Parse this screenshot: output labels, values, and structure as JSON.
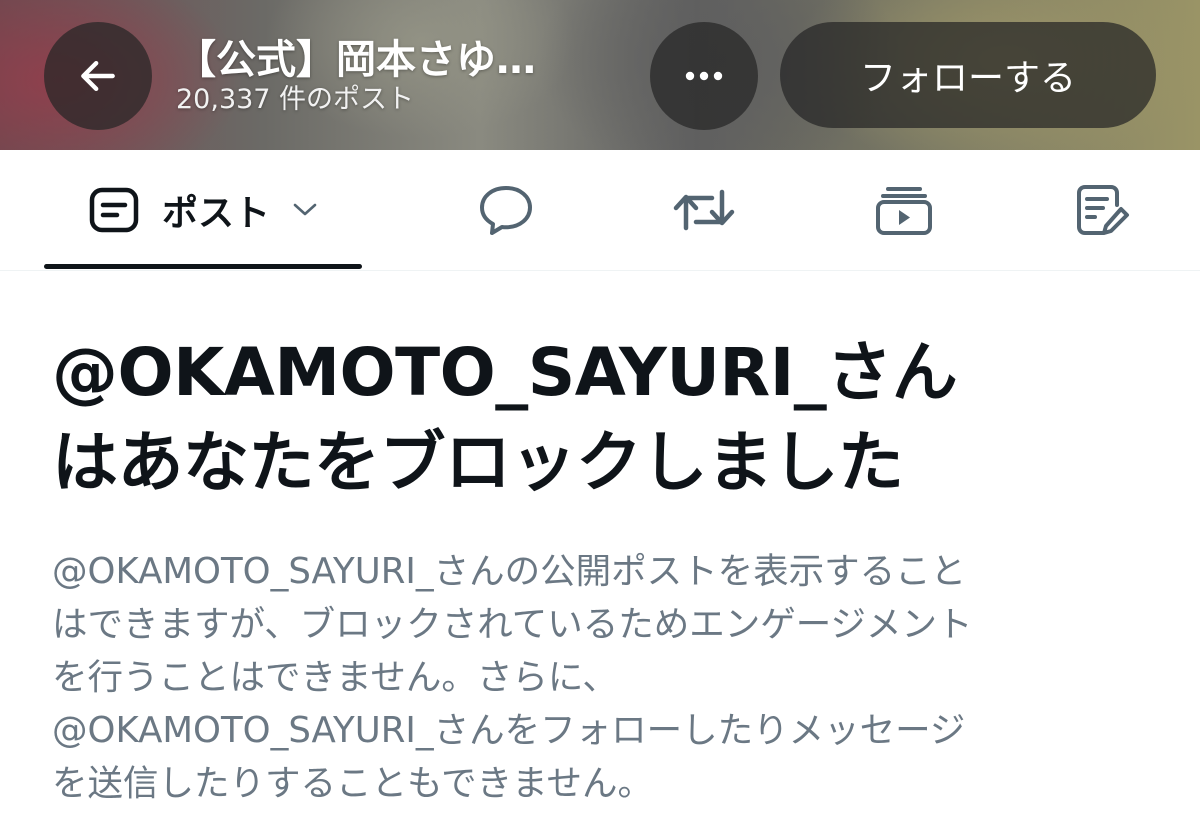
{
  "header": {
    "profile_name": "【公式】岡本さゆ…",
    "post_count": "20,337 件のポスト",
    "follow_label": "フォローする",
    "back_icon": "arrow-left-icon",
    "more_icon": "more-horizontal-icon"
  },
  "tabs": {
    "posts_label": "ポスト",
    "items": [
      {
        "name": "posts",
        "icon": "post-icon",
        "active": true
      },
      {
        "name": "replies",
        "icon": "reply-bubble-icon",
        "active": false
      },
      {
        "name": "reposts",
        "icon": "repost-icon",
        "active": false
      },
      {
        "name": "media",
        "icon": "video-play-icon",
        "active": false
      },
      {
        "name": "articles",
        "icon": "edit-document-icon",
        "active": false
      }
    ]
  },
  "blocked": {
    "title_lines": [
      "@OKAMOTO_SAYURI_さん",
      "はあなたをブロックしました"
    ],
    "description_lines": [
      "@OKAMOTO_SAYURI_さんの公開ポストを表示すること",
      "はできますが、ブロックされているためエンゲージメント",
      "を行うことはできません。さらに、",
      "@OKAMOTO_SAYURI_さんをフォローしたりメッセージ",
      "を送信したりすることもできません。"
    ]
  },
  "colors": {
    "text_primary": "#0f1419",
    "text_secondary": "#6b7884",
    "header_button_bg": "#262626",
    "icon_gray": "#536471"
  }
}
